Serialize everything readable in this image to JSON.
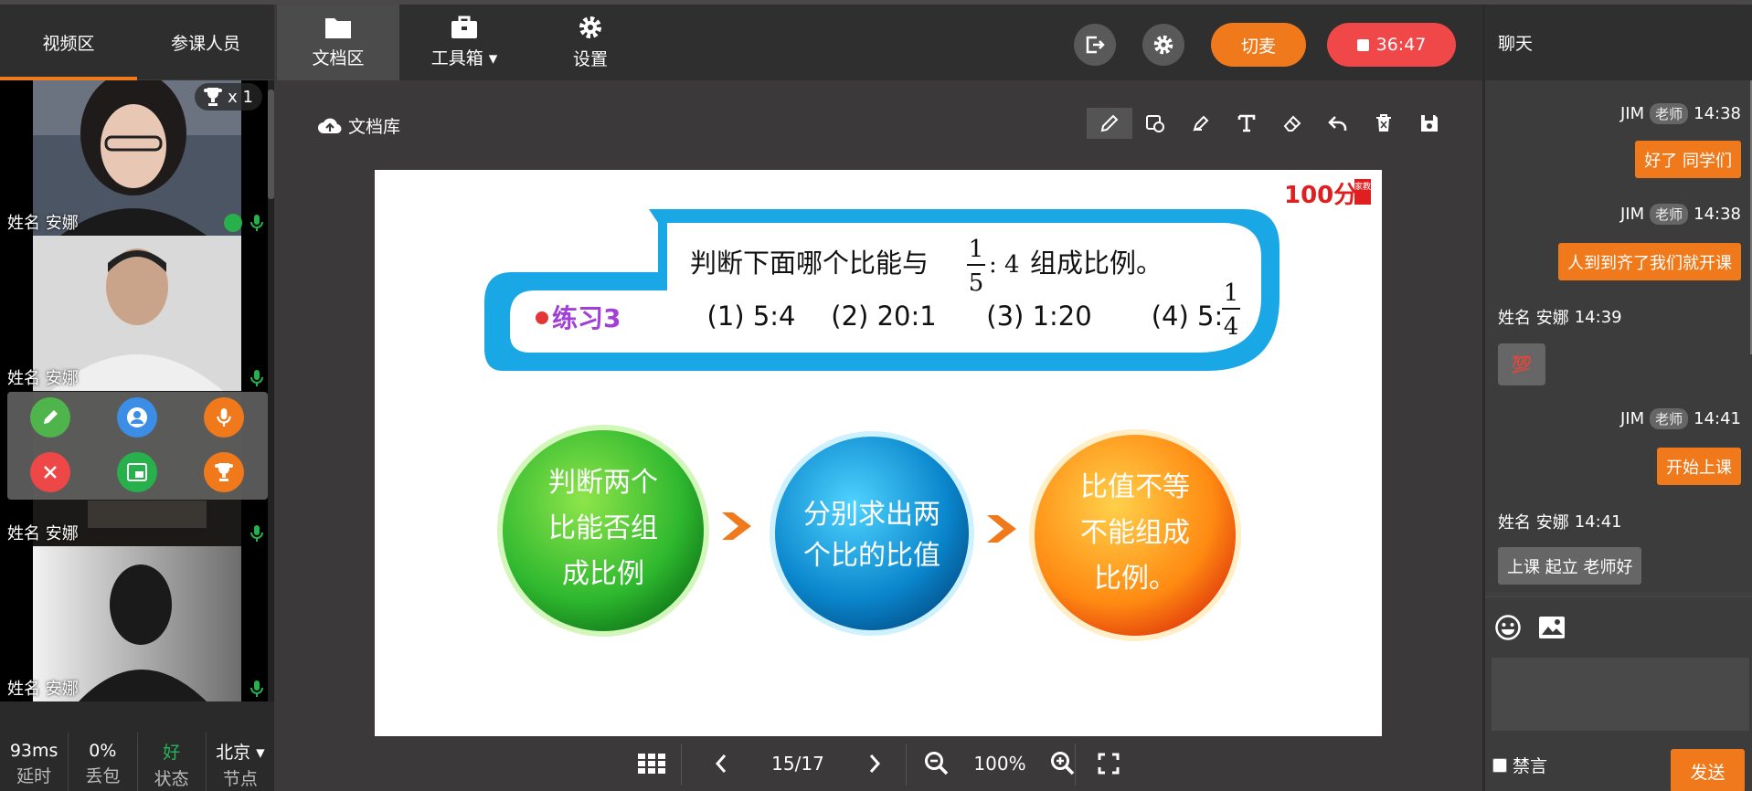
{
  "left": {
    "tabs": [
      "视频区",
      "参课人员"
    ],
    "trophy_count": "x 1",
    "videos": [
      {
        "name": "姓名 安娜"
      },
      {
        "name": "姓名 安娜"
      },
      {
        "name": "姓名 安娜"
      },
      {
        "name": "姓名 安娜"
      }
    ],
    "stats": [
      {
        "value": "93ms",
        "label": "延时"
      },
      {
        "value": "0%",
        "label": "丢包"
      },
      {
        "value": "好",
        "label": "状态"
      },
      {
        "value": "北京 ▾",
        "label": "节点"
      }
    ]
  },
  "toolbar": {
    "doc": "文档区",
    "toolbox": "工具箱 ▾",
    "settings": "设置",
    "switch_mic": "切麦",
    "record_time": "36:47"
  },
  "docarea": {
    "doclib": "文档库"
  },
  "slide": {
    "brand": "100分",
    "brand_side": "家教",
    "exercise": "练习3",
    "question_pre": "判断下面哪个比能与",
    "frac_num": "1",
    "frac_den": "5",
    "question_ratio": ": 4",
    "question_post": "组成比例。",
    "options": [
      "(1) 5:4",
      "(2) 20:1",
      "(3) 1:20",
      "(4) 5:"
    ],
    "opt4_num": "1",
    "opt4_den": "4",
    "step1": [
      "判断两个",
      "比能否组",
      "成比例"
    ],
    "step2": [
      "分别求出两",
      "个比的比值"
    ],
    "step3": [
      "比值不等",
      "不能组成",
      "比例。"
    ]
  },
  "pager": {
    "page": "15/17",
    "zoom": "100%"
  },
  "chat": {
    "title": "聊天",
    "messages": [
      {
        "meta_name": "JIM",
        "tag": "老师",
        "time": "14:38",
        "text": "好了 同学们"
      },
      {
        "meta_name": "JIM",
        "tag": "老师",
        "time": "14:38",
        "text": "人到到齐了我们就开课"
      },
      {
        "meta_name": "姓名 安娜",
        "time": "14:39",
        "text": "💯"
      },
      {
        "meta_name": "JIM",
        "tag": "老师",
        "time": "14:41",
        "text": "开始上课"
      },
      {
        "meta_name": "姓名 安娜",
        "time": "14:41",
        "text": "上课 起立 老师好"
      }
    ],
    "mute_label": "禁言",
    "send_label": "发送"
  },
  "colors": {
    "accent": "#f07a1b",
    "record": "#f04848",
    "good": "#25b35a",
    "slide_blue": "#1aa7e6",
    "exercise_purple": "#a23fd6"
  }
}
